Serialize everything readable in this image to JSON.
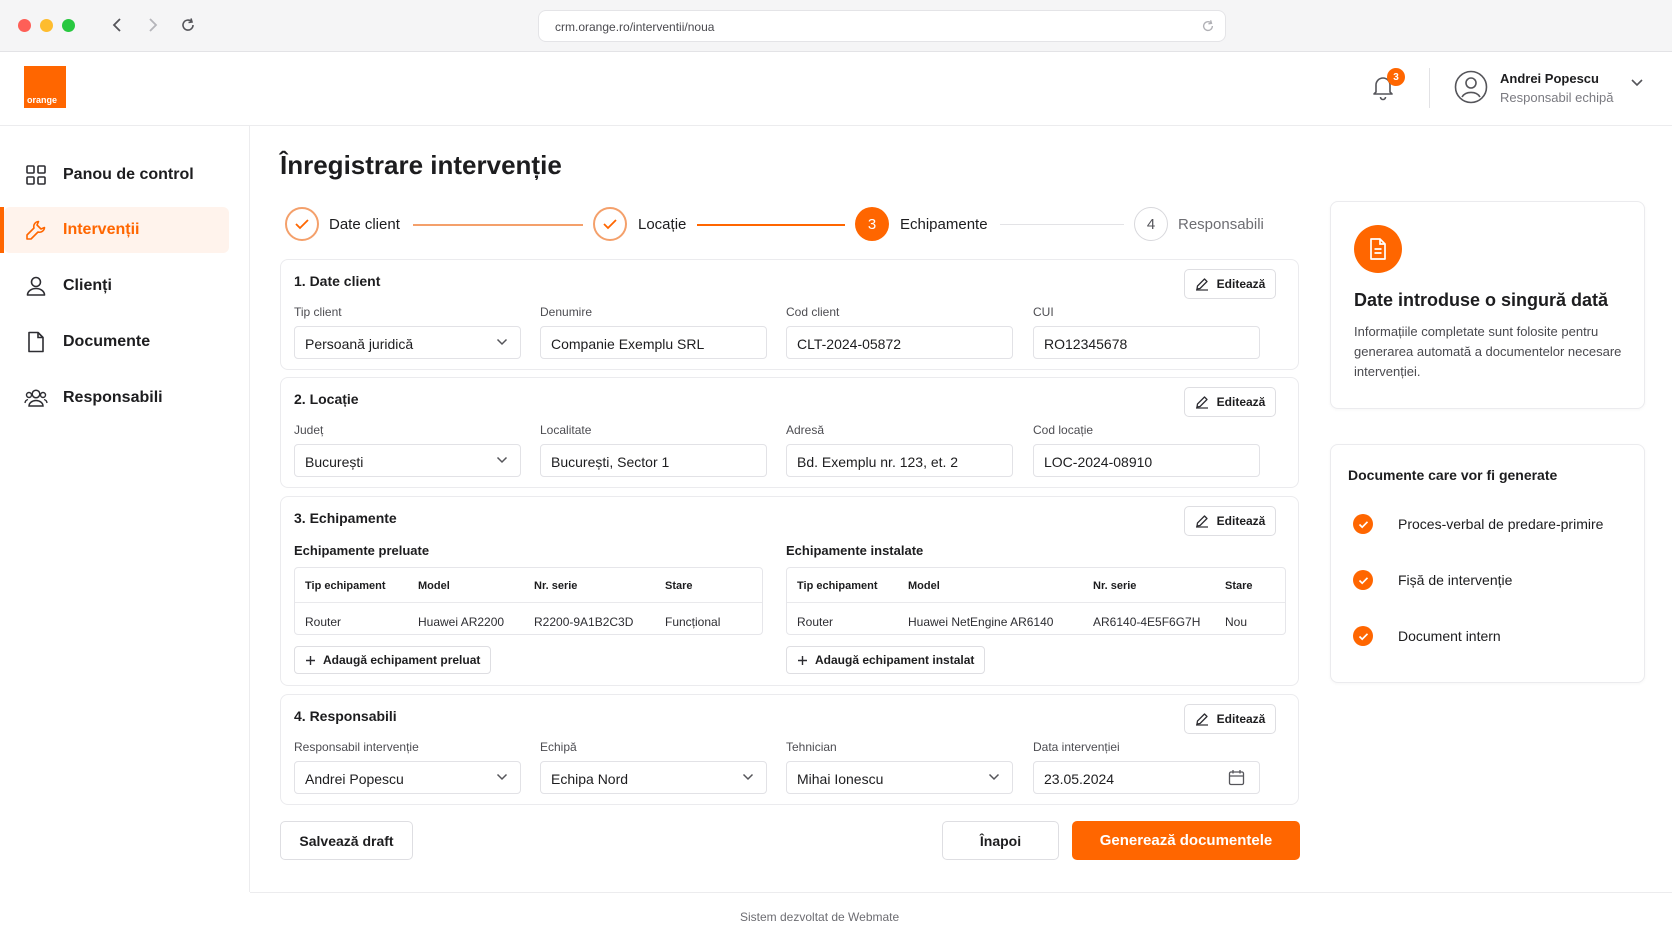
{
  "browser": {
    "url": "crm.orange.ro/interventii/noua"
  },
  "header": {
    "logo_text": "orange",
    "notifications_count": "3",
    "user_name": "Andrei Popescu",
    "user_role": "Responsabil echipă"
  },
  "sidebar": {
    "items": [
      {
        "label": "Panou de control"
      },
      {
        "label": "Intervenții"
      },
      {
        "label": "Clienți"
      },
      {
        "label": "Documente"
      },
      {
        "label": "Responsabili"
      }
    ]
  },
  "page": {
    "title": "Înregistrare intervenție"
  },
  "stepper": {
    "steps": [
      {
        "label": "Date client",
        "state": "done"
      },
      {
        "label": "Locație",
        "state": "done"
      },
      {
        "number": "3",
        "label": "Echipamente",
        "state": "current"
      },
      {
        "number": "4",
        "label": "Responsabili",
        "state": "todo"
      }
    ]
  },
  "edit_label": "Editează",
  "client": {
    "title": "1. Date client",
    "tip_label": "Tip client",
    "tip_value": "Persoană juridică",
    "denumire_label": "Denumire",
    "denumire_value": "Companie Exemplu SRL",
    "cod_label": "Cod client",
    "cod_value": "CLT-2024-05872",
    "cui_label": "CUI",
    "cui_value": "RO12345678"
  },
  "location": {
    "title": "2. Locație",
    "judet_label": "Județ",
    "judet_value": "București",
    "localitate_label": "Localitate",
    "localitate_value": "București, Sector 1",
    "adresa_label": "Adresă",
    "adresa_value": "Bd. Exemplu nr. 123, et. 2",
    "cod_label": "Cod locație",
    "cod_value": "LOC-2024-08910"
  },
  "equipment": {
    "title": "3. Echipamente",
    "taken": {
      "title": "Echipamente preluate",
      "headers": [
        "Tip echipament",
        "Model",
        "Nr. serie",
        "Stare"
      ],
      "row": [
        "Router",
        "Huawei AR2200",
        "R2200-9A1B2C3D",
        "Funcțional"
      ],
      "add_label": "Adaugă echipament preluat"
    },
    "installed": {
      "title": "Echipamente instalate",
      "headers": [
        "Tip echipament",
        "Model",
        "Nr. serie",
        "Stare"
      ],
      "row": [
        "Router",
        "Huawei NetEngine AR6140",
        "AR6140-4E5F6G7H",
        "Nou"
      ],
      "add_label": "Adaugă echipament instalat"
    }
  },
  "responsible": {
    "title": "4. Responsabili",
    "resp_label": "Responsabil intervenție",
    "resp_value": "Andrei Popescu",
    "echipa_label": "Echipă",
    "echipa_value": "Echipa Nord",
    "tehnician_label": "Tehnician",
    "tehnician_value": "Mihai Ionescu",
    "data_label": "Data intervenției",
    "data_value": "23.05.2024"
  },
  "actions": {
    "save_draft": "Salvează draft",
    "back": "Înapoi",
    "generate": "Generează documentele"
  },
  "info_panel": {
    "title": "Date introduse o singură dată",
    "text": "Informațiile completate sunt folosite pentru generarea automată a documentelor necesare intervenției."
  },
  "docs_panel": {
    "title": "Documente care vor fi generate",
    "items": [
      "Proces-verbal de predare-primire",
      "Fișă de intervenție",
      "Document intern"
    ]
  },
  "footer": {
    "text": "Sistem dezvoltat de Webmate"
  },
  "colors": {
    "accent": "#ff6600",
    "accent_light": "#fff3ec"
  }
}
